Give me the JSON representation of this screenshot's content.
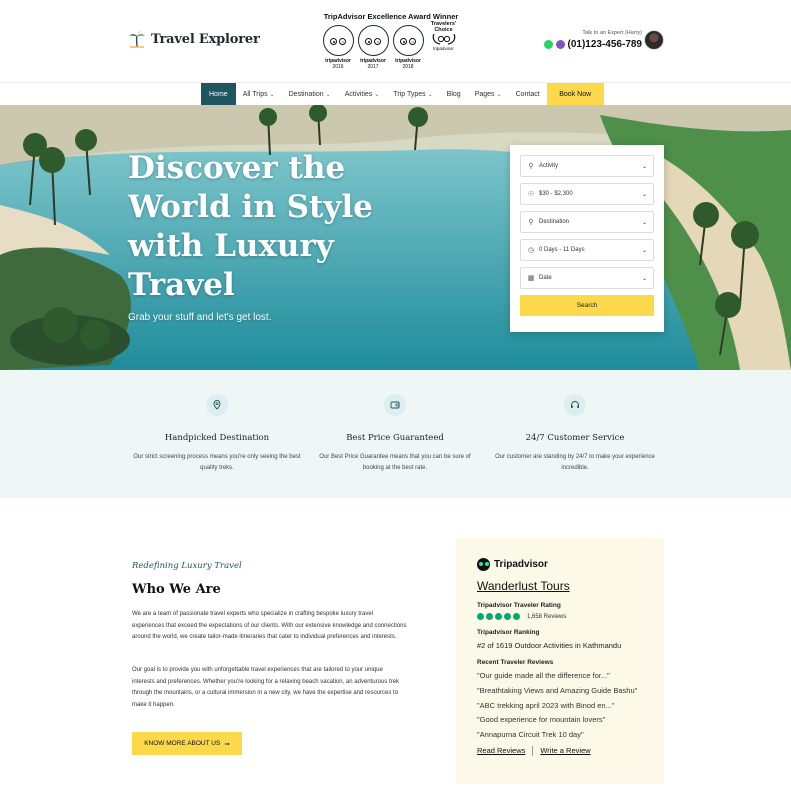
{
  "header": {
    "logo_text": "Travel Explorer",
    "award_title": "TripAdvisor Excellence Award Winner",
    "badges": [
      {
        "brand": "tripadvisor",
        "year": "2016"
      },
      {
        "brand": "tripadvisor",
        "year": "2017"
      },
      {
        "brand": "tripadvisor",
        "year": "2018"
      }
    ],
    "travelers_choice": "Travelers' Choice",
    "travelers_choice_brand": "tripadvisor",
    "expert_label": "Talk to an Expert (Harry)",
    "phone": "(01)123-456-789"
  },
  "nav": {
    "items": [
      {
        "label": "Home",
        "active": true
      },
      {
        "label": "All Trips",
        "caret": true
      },
      {
        "label": "Destination",
        "caret": true
      },
      {
        "label": "Activities",
        "caret": true
      },
      {
        "label": "Trip Types",
        "caret": true
      },
      {
        "label": "Blog"
      },
      {
        "label": "Pages",
        "caret": true
      },
      {
        "label": "Contact"
      }
    ],
    "book_label": "Book Now"
  },
  "hero": {
    "title": "Discover the World in Style with Luxury Travel",
    "subtitle": "Grab your stuff and let's get lost.",
    "search": {
      "fields": [
        {
          "icon": "bicycle-icon",
          "value": "Activity"
        },
        {
          "icon": "dollar-icon",
          "value": "$30 - $2,300"
        },
        {
          "icon": "location-pin-icon",
          "value": "Destination"
        },
        {
          "icon": "clock-icon",
          "value": "0 Days - 11 Days"
        },
        {
          "icon": "calendar-icon",
          "value": "Date"
        }
      ],
      "button_label": "Search"
    }
  },
  "features": [
    {
      "icon": "map-pin-icon",
      "title": "Handpicked Destination",
      "desc": "Our strict screening process means you're only seeing the best quality treks."
    },
    {
      "icon": "wallet-icon",
      "title": "Best Price Guaranteed",
      "desc": "Our Best Price Guarantee means that you can be sure of booking at the best rate."
    },
    {
      "icon": "headset-icon",
      "title": "24/7 Customer Service",
      "desc": "Our customer are standing by 24/7 to make your experience incredible."
    }
  ],
  "about": {
    "tagline": "Redefining Luxury Travel",
    "title": "Who We Are",
    "para1": "We are a team of passionate travel experts who specialize in crafting bespoke luxury travel experiences that exceed the expectations of our clients. With our extensive knowledge and connections around the world, we create tailor-made itineraries that cater to individual preferences and interests.",
    "para2": "Our goal is to provide you with unforgettable travel experiences that are tailored to your unique interests and preferences. Whether you're looking for a relaxing beach vacation, an adventurous trek through the mountains, or a cultural immersion in a new city, we have the expertise and resources to make it happen.",
    "button_label": "KNOW MORE ABOUT US"
  },
  "tripadvisor": {
    "brand": "Tripadvisor",
    "name": "Wanderlust Tours",
    "rating_label": "Tripadvisor Traveler Rating",
    "rating_bubbles": 5,
    "review_count": "1,658 Reviews",
    "ranking_label": "Tripadvisor Ranking",
    "ranking": "#2 of 1619 Outdoor Activities in Kathmandu",
    "recent_label": "Recent Traveler Reviews",
    "reviews": [
      "\"Our guide made all the difference for...\"",
      "\"Breathtaking Views and Amazing Guide Bashu\"",
      "\"ABC trekking april 2023 with Binod en...\"",
      "\"Good experience for mountain lovers\"",
      "\"Annapurna Circuit Trek 10 day\""
    ],
    "read_reviews": "Read Reviews",
    "write_review": "Write a Review"
  },
  "colors": {
    "accent": "#1f5560",
    "yellow": "#fbd94b",
    "feature_bg": "#eef7f6",
    "ta_bg": "#fdf9e8"
  }
}
